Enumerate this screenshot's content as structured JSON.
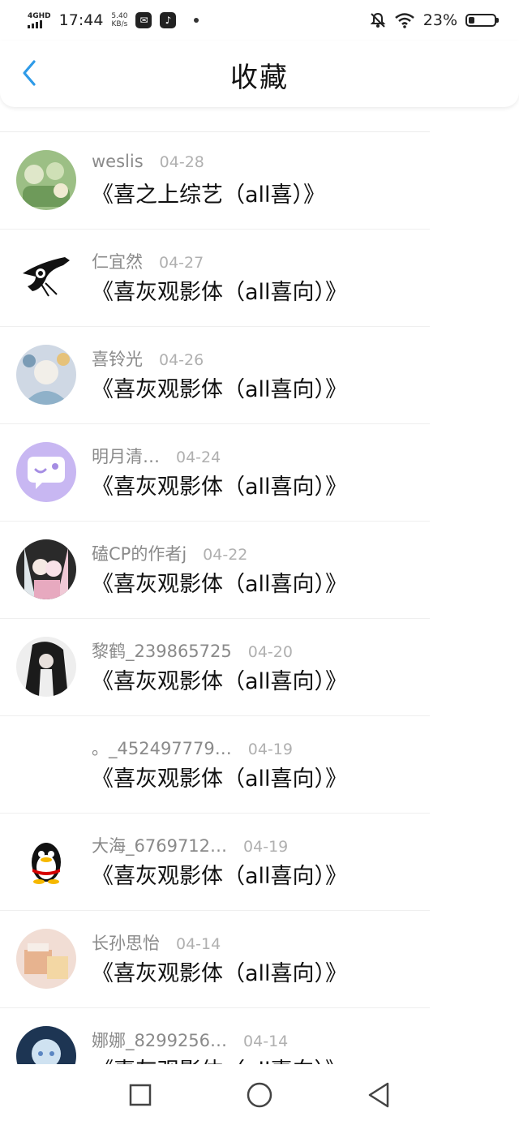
{
  "status_bar": {
    "network": "4GHD",
    "time": "17:44",
    "speed_value": "5.40",
    "speed_unit": "KB/s",
    "battery": "23%",
    "battery_level": 0.23
  },
  "header": {
    "title": "收藏",
    "back_icon": "chevron-left-icon",
    "accent": "#2f9be8"
  },
  "favorites": [
    {
      "name": "weslis",
      "date": "04-28",
      "title": "《喜之上综艺（all喜）》",
      "avatar": "photo-green"
    },
    {
      "name": "仁宜然",
      "date": "04-27",
      "title": "《喜灰观影体（all喜向）》",
      "avatar": "ink-sketch"
    },
    {
      "name": "喜铃光",
      "date": "04-26",
      "title": "《喜灰观影体（all喜向）》",
      "avatar": "photo-blue"
    },
    {
      "name": "明月清…",
      "date": "04-24",
      "title": "《喜灰观影体（all喜向）》",
      "avatar": "default-chat"
    },
    {
      "name": "磕CP的作者j",
      "date": "04-22",
      "title": "《喜灰观影体（all喜向）》",
      "avatar": "photo-anime"
    },
    {
      "name": "黎鹤_239865725",
      "date": "04-20",
      "title": "《喜灰观影体（all喜向）》",
      "avatar": "photo-dark"
    },
    {
      "name": "。_452497779…",
      "date": "04-19",
      "title": "《喜灰观影体（all喜向）》",
      "avatar": "blank"
    },
    {
      "name": "大海_6769712…",
      "date": "04-19",
      "title": "《喜灰观影体（all喜向）》",
      "avatar": "penguin"
    },
    {
      "name": "长孙思怡",
      "date": "04-14",
      "title": "《喜灰观影体（all喜向）》",
      "avatar": "photo-peach"
    },
    {
      "name": "娜娜_8299256…",
      "date": "04-14",
      "title": "《喜灰观影体（all喜向）》",
      "avatar": "photo-blue-anime"
    }
  ],
  "nav": {
    "recent": "square-icon",
    "home": "circle-icon",
    "back": "triangle-back-icon"
  }
}
